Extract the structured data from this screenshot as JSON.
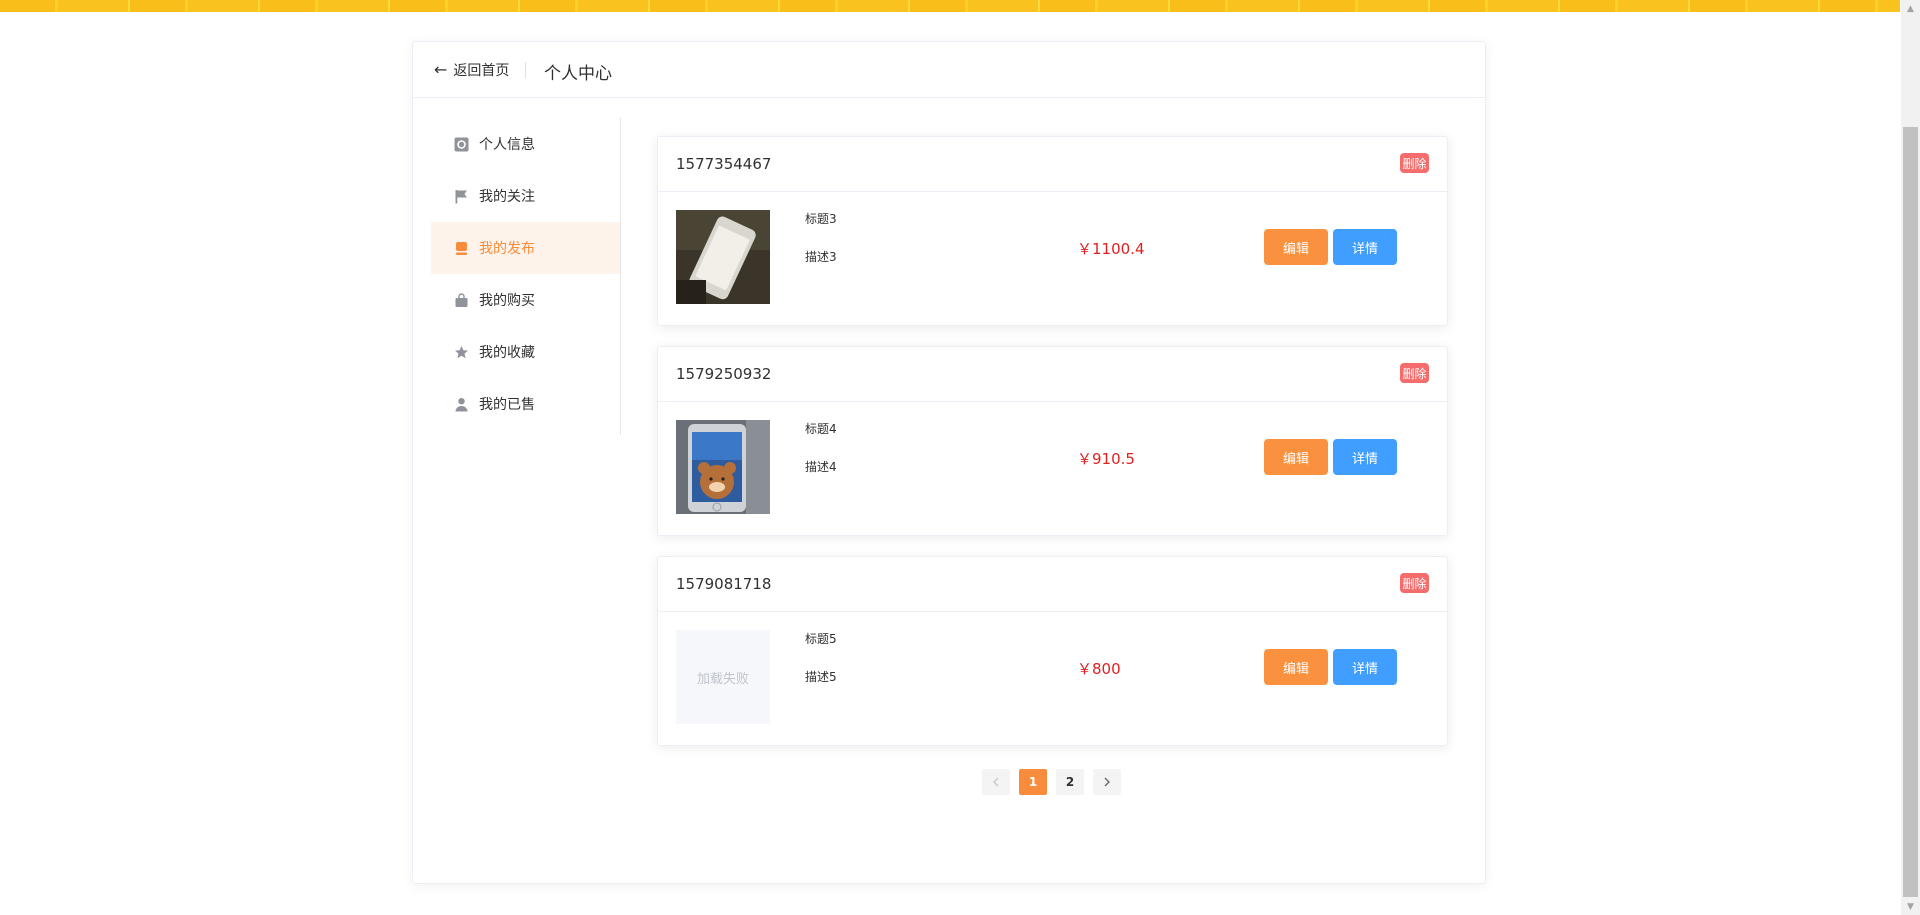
{
  "header": {
    "back_label": "返回首页",
    "title": "个人中心"
  },
  "sidebar": {
    "items": [
      {
        "label": "个人信息",
        "icon": "profile-icon",
        "active": false
      },
      {
        "label": "我的关注",
        "icon": "flag-icon",
        "active": false
      },
      {
        "label": "我的发布",
        "icon": "publish-icon",
        "active": true
      },
      {
        "label": "我的购买",
        "icon": "bag-icon",
        "active": false
      },
      {
        "label": "我的收藏",
        "icon": "star-icon",
        "active": false
      },
      {
        "label": "我的已售",
        "icon": "user-icon",
        "active": false
      }
    ]
  },
  "products": [
    {
      "id": "1577354467",
      "title": "标题3",
      "desc": "描述3",
      "price": "￥1100.4",
      "image": "phone-photo-white"
    },
    {
      "id": "1579250932",
      "title": "标题4",
      "desc": "描述4",
      "price": "￥910.5",
      "image": "phone-photo-bear"
    },
    {
      "id": "1579081718",
      "title": "标题5",
      "desc": "描述5",
      "price": "￥800",
      "image_failed_text": "加载失败"
    }
  ],
  "actions": {
    "delete_label": "删除",
    "edit_label": "编辑",
    "detail_label": "详情"
  },
  "pagination": {
    "current": 1,
    "pages": [
      "1",
      "2"
    ],
    "prev_icon": "chevron-left-icon",
    "next_icon": "chevron-right-icon"
  },
  "colors": {
    "accent": "#f98c3c",
    "edit": "#f9913f",
    "detail": "#409eff",
    "delete": "#f56c6c",
    "price": "#e02020",
    "active_bg": "#fdf3ea"
  }
}
